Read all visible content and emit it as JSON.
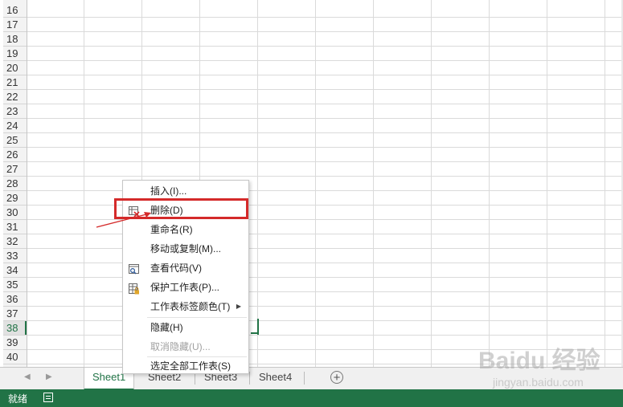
{
  "rows": [
    "16",
    "17",
    "18",
    "19",
    "20",
    "21",
    "22",
    "23",
    "24",
    "25",
    "26",
    "27",
    "28",
    "29",
    "30",
    "31",
    "32",
    "33",
    "34",
    "35",
    "36",
    "37",
    "38",
    "39",
    "40"
  ],
  "active_row": "38",
  "sheet_tabs": [
    "Sheet1",
    "Sheet2",
    "Sheet3",
    "Sheet4"
  ],
  "active_tab": "Sheet1",
  "status": {
    "text": "就绪"
  },
  "context_menu": {
    "items": [
      {
        "label": "插入(I)...",
        "icon": "",
        "disabled": false
      },
      {
        "label": "删除(D)",
        "icon": "delete-sheet-icon",
        "disabled": false
      },
      {
        "label": "重命名(R)",
        "icon": "",
        "disabled": false
      },
      {
        "label": "移动或复制(M)...",
        "icon": "",
        "disabled": false
      },
      {
        "label": "查看代码(V)",
        "icon": "view-code-icon",
        "disabled": false
      },
      {
        "label": "保护工作表(P)...",
        "icon": "protect-sheet-icon",
        "disabled": false
      },
      {
        "label": "工作表标签颜色(T)",
        "icon": "",
        "disabled": false,
        "submenu": true
      },
      {
        "label": "隐藏(H)",
        "icon": "",
        "disabled": false
      },
      {
        "label": "取消隐藏(U)...",
        "icon": "",
        "disabled": true
      },
      {
        "label": "选定全部工作表(S)",
        "icon": "",
        "disabled": false
      }
    ]
  },
  "watermark": {
    "logo": "Baidu 经验",
    "sub": "jingyan.baidu.com"
  },
  "colors": {
    "accent": "#217346",
    "highlight": "#d42a2a"
  }
}
